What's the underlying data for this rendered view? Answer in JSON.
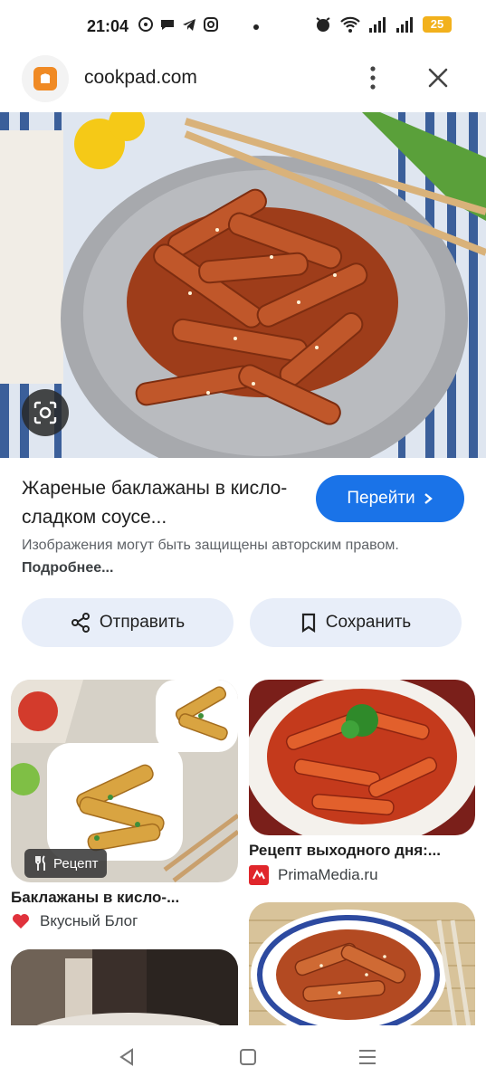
{
  "status_bar": {
    "time": "21:04",
    "battery": "25",
    "icons": [
      "viber-icon",
      "chat-icon",
      "telegram-icon",
      "instagram-icon",
      "alarm-icon",
      "wifi-icon",
      "signal-icon",
      "signal-icon-2",
      "battery-icon"
    ]
  },
  "url_bar": {
    "site": "cookpad.com"
  },
  "preview": {
    "title": "Жареные баклажаны в кисло-сладком соусе...",
    "go_button": "Перейти",
    "copyright_text": "Изображения могут быть защищены авторским правом.",
    "more_link": "Подробнее..."
  },
  "actions": {
    "send": "Отправить",
    "save": "Сохранить"
  },
  "related": [
    {
      "badge": "Рецепт",
      "title": "Баклажаны в кисло-...",
      "source": "Вкусный Блог"
    },
    {
      "title": "Рецепт выходного дня:...",
      "source": "PrimaMedia.ru"
    },
    {},
    {}
  ],
  "colors": {
    "accent": "#1a73e8",
    "pill_bg": "#e8eef9",
    "site_icon": "#f08a24",
    "battery": "#f2b11c"
  }
}
